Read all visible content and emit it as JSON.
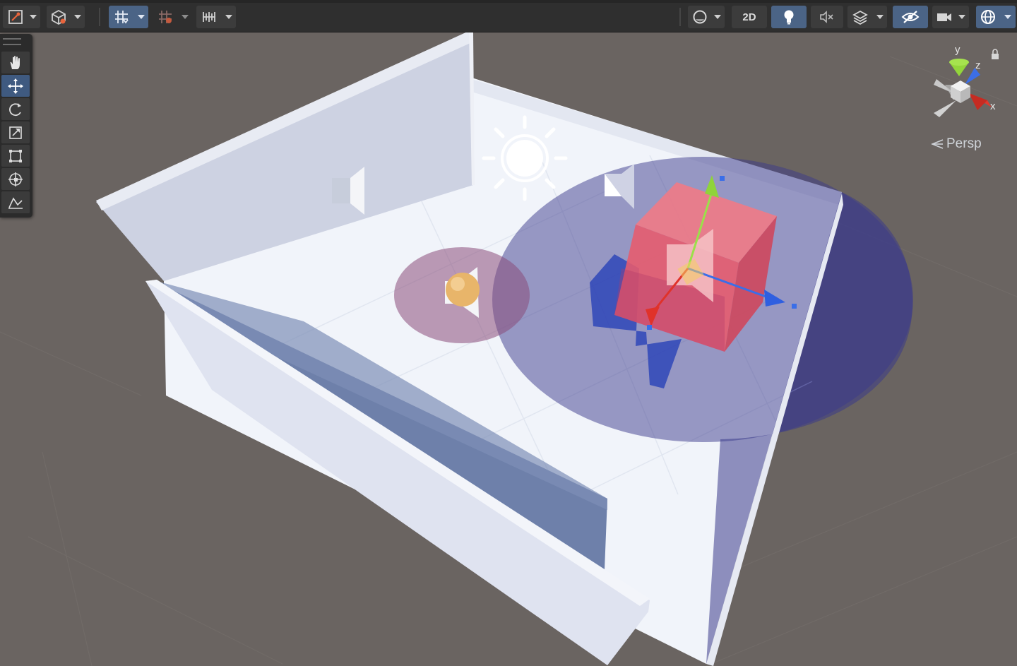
{
  "toolbar": {
    "left_buttons": [
      {
        "name": "draw-mode",
        "icon": "draw-mode-icon"
      },
      {
        "name": "render-layers",
        "icon": "cube-icon"
      },
      {
        "name": "grid-snap",
        "icon": "grid-snap-icon",
        "active": true
      },
      {
        "name": "increment-snap",
        "icon": "increment-snap-icon"
      },
      {
        "name": "snap-settings",
        "icon": "ruler-icon"
      }
    ],
    "right_buttons": [
      {
        "name": "shading-mode",
        "icon": "sphere-icon"
      },
      {
        "name": "2d-toggle",
        "label": "2D"
      },
      {
        "name": "lighting-toggle",
        "icon": "lightbulb-icon",
        "active": true
      },
      {
        "name": "audio-toggle",
        "icon": "audio-mute-icon"
      },
      {
        "name": "effects",
        "icon": "layers-icon"
      },
      {
        "name": "scene-visibility",
        "icon": "hidden-eye-icon",
        "active": true
      },
      {
        "name": "camera",
        "icon": "camera-icon"
      },
      {
        "name": "gizmos",
        "icon": "gizmo-globe-icon",
        "active": true
      }
    ],
    "mode_2d_label": "2D"
  },
  "tools": [
    {
      "name": "view-tool",
      "icon": "hand-icon"
    },
    {
      "name": "move-tool",
      "icon": "move-arrows-icon",
      "active": true
    },
    {
      "name": "rotate-tool",
      "icon": "rotate-icon"
    },
    {
      "name": "scale-tool",
      "icon": "scale-icon"
    },
    {
      "name": "rect-tool",
      "icon": "rect-transform-icon"
    },
    {
      "name": "transform-tool",
      "icon": "transform-icon"
    },
    {
      "name": "custom-tool",
      "icon": "custom-tool-icon"
    }
  ],
  "gizmo": {
    "axis_y": "y",
    "axis_z": "z",
    "axis_x": "x",
    "projection": "Persp"
  },
  "colors": {
    "background": "#6a6461",
    "toolbar": "#2f2f2f",
    "active_button": "#4b6486",
    "room_wall": "#d8dcea",
    "floor": "#f2f5fb",
    "audio_range_large": "#3c3a8c",
    "audio_range_small": "#8a4f7a",
    "cube": "#f06a7a",
    "axis_x": "#e0322a",
    "axis_y": "#8fd43a",
    "axis_z": "#3a6ee8"
  }
}
